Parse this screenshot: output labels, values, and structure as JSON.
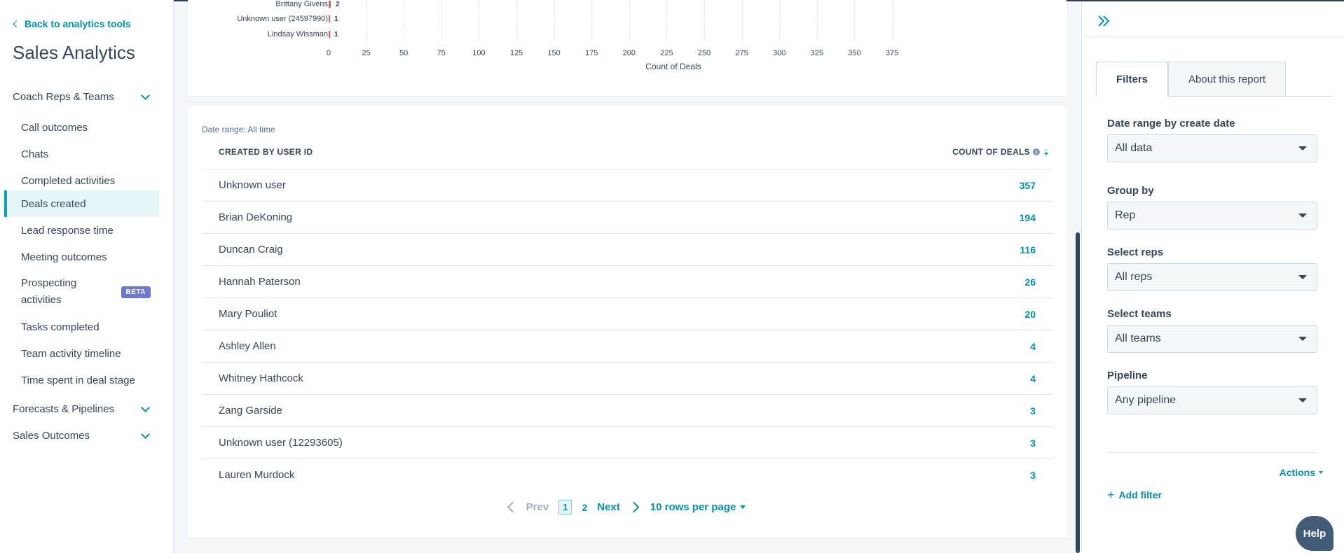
{
  "sidebar": {
    "back_label": "Back to analytics tools",
    "title": "Sales Analytics",
    "groups": [
      {
        "label": "Coach Reps & Teams"
      },
      {
        "label": "Forecasts & Pipelines"
      },
      {
        "label": "Sales Outcomes"
      }
    ],
    "items": [
      {
        "label": "Call outcomes"
      },
      {
        "label": "Chats"
      },
      {
        "label": "Completed activities"
      },
      {
        "label": "Deals created"
      },
      {
        "label": "Lead response time"
      },
      {
        "label": "Meeting outcomes"
      },
      {
        "label": "Prospecting activities",
        "badge": "BETA"
      },
      {
        "label": "Tasks completed"
      },
      {
        "label": "Team activity timeline"
      },
      {
        "label": "Time spent in deal stage"
      }
    ]
  },
  "chart": {
    "bars": [
      {
        "label": "Brittany Givens",
        "value": "2"
      },
      {
        "label": "Unknown user (24597990)",
        "value": "1"
      },
      {
        "label": "Lindsay Wissman",
        "value": "1"
      }
    ],
    "ticks": [
      "0",
      "25",
      "50",
      "75",
      "100",
      "125",
      "150",
      "175",
      "200",
      "225",
      "250",
      "275",
      "300",
      "325",
      "350",
      "375"
    ],
    "xlabel": "Count of Deals"
  },
  "table": {
    "date_range": "Date range: All time",
    "col_user": "CREATED BY USER ID",
    "col_count": "COUNT OF DEALS",
    "info_glyph": "i",
    "rows": [
      {
        "name": "Unknown user",
        "count": "357"
      },
      {
        "name": "Brian DeKoning",
        "count": "194"
      },
      {
        "name": "Duncan Craig",
        "count": "116"
      },
      {
        "name": "Hannah Paterson",
        "count": "26"
      },
      {
        "name": "Mary Pouliot",
        "count": "20"
      },
      {
        "name": "Ashley Allen",
        "count": "4"
      },
      {
        "name": "Whitney Hathcock",
        "count": "4"
      },
      {
        "name": "Zang Garside",
        "count": "3"
      },
      {
        "name": "Unknown user (12293605)",
        "count": "3"
      },
      {
        "name": "Lauren Murdock",
        "count": "3"
      }
    ],
    "pager": {
      "prev": "Prev",
      "current": "1",
      "page2": "2",
      "next": "Next",
      "rows_per_page": "10 rows per page"
    }
  },
  "panel": {
    "tabs": [
      {
        "label": "Filters"
      },
      {
        "label": "About this report"
      }
    ],
    "filters": [
      {
        "label": "Date range by create date",
        "value": "All data"
      },
      {
        "label": "Group by",
        "value": "Rep"
      },
      {
        "label": "Select reps",
        "value": "All reps"
      },
      {
        "label": "Select teams",
        "value": "All teams"
      },
      {
        "label": "Pipeline",
        "value": "Any pipeline"
      }
    ],
    "actions_label": "Actions",
    "add_filter_label": "Add filter",
    "plus_glyph": "+"
  },
  "help_label": "Help",
  "colors": {
    "accent": "#0091ae",
    "bar": "#f2545b",
    "text": "#33475b",
    "beta": "#6a78d1"
  }
}
